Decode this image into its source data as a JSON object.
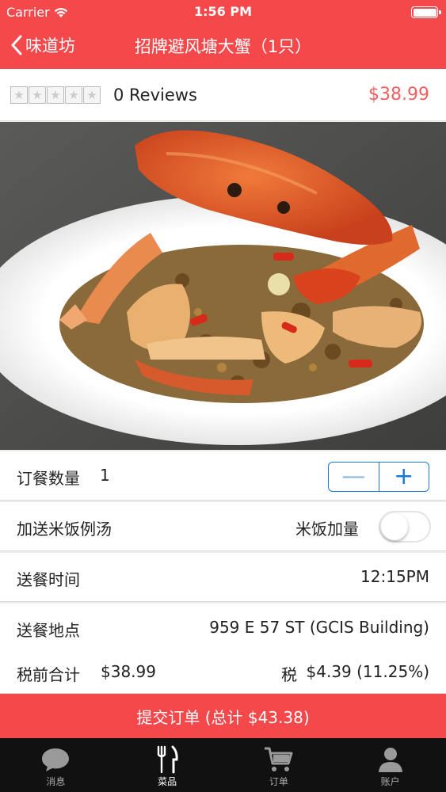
{
  "status_bar": {
    "carrier": "Carrier",
    "time": "1:56 PM"
  },
  "nav": {
    "back_label": "味道坊",
    "title": "招牌避风塘大蟹（1只）"
  },
  "item": {
    "reviews": "0 Reviews",
    "price": "$38.99",
    "rating_stars": 0,
    "rating_max": 5
  },
  "order": {
    "quantity_label": "订餐数量",
    "quantity_value": "1",
    "minus_glyph": "—",
    "plus_glyph": "+",
    "rice_soup_label": "加送米饭例汤",
    "extra_rice_label": "米饭加量",
    "extra_rice_on": false,
    "delivery_time_label": "送餐时间",
    "delivery_time_value": "12:15PM",
    "delivery_address_label": "送餐地点",
    "delivery_address_value": "959 E 57 ST (GCIS Building)",
    "subtotal_label": "税前合计",
    "subtotal_value": "$38.99",
    "tax_label": "税",
    "tax_value": "$4.39 (11.25%)"
  },
  "submit_label": "提交订单 (总计 $43.38)",
  "tabs": [
    {
      "label": "消息",
      "icon": "chat-bubble-icon",
      "active": false
    },
    {
      "label": "菜品",
      "icon": "fork-knife-icon",
      "active": true
    },
    {
      "label": "订单",
      "icon": "shopping-cart-icon",
      "active": false
    },
    {
      "label": "账户",
      "icon": "user-icon",
      "active": false
    }
  ],
  "colors": {
    "brand_red": "#f4484b",
    "price_red": "#f06060",
    "ios_blue": "#1a7ad8"
  }
}
